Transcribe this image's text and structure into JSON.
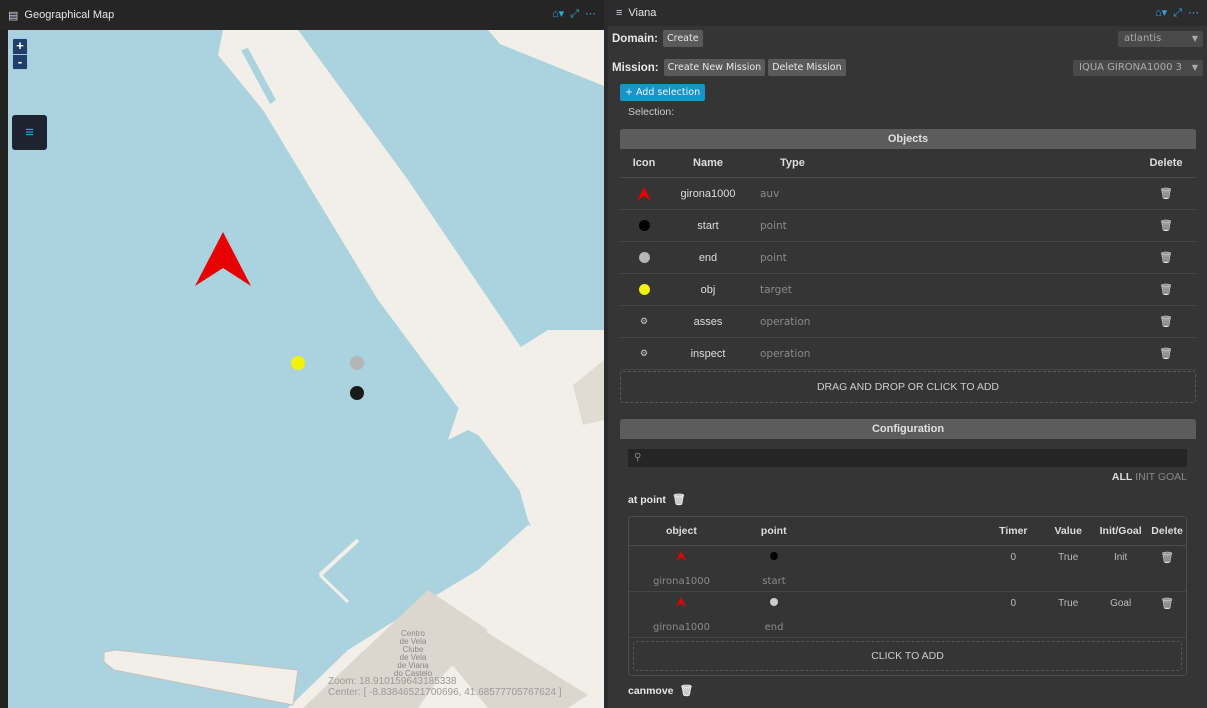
{
  "map_panel": {
    "title": "Geographical Map",
    "zoom_in": "+",
    "zoom_out": "-",
    "place_label": [
      "Centro",
      "de Vela",
      "Clube",
      "de Vela",
      "de Viana",
      "do Castelo"
    ],
    "zoom_text": "Zoom: 18.910159643185338",
    "center_text": "Center: [ -8.83846521700696, 41.68577705767624 ]",
    "markers": {
      "auv_color": "#e60000",
      "yellow": "#f2f20a",
      "gray": "#b5b5b5",
      "black": "#1a1a1a"
    }
  },
  "right_panel": {
    "title": "Viana",
    "domain_label": "Domain:",
    "create_button": "Create",
    "domain_select": "atlantis",
    "mission_label": "Mission:",
    "create_mission_button": "Create New Mission",
    "delete_mission_button": "Delete Mission",
    "mission_select": "IQUA GIRONA1000 3",
    "add_selection_button": "+ Add selection",
    "selection_label": "Selection:",
    "objects_title": "Objects",
    "objects_headers": [
      "Icon",
      "Name",
      "Type",
      "Delete"
    ],
    "objects": [
      {
        "icon": "auv-arrow-icon",
        "name": "girona1000",
        "type": "auv",
        "color": "#e60000"
      },
      {
        "icon": "black-dot-icon",
        "name": "start",
        "type": "point",
        "color": "#000000"
      },
      {
        "icon": "gray-dot-icon",
        "name": "end",
        "type": "point",
        "color": "#b5b5b5"
      },
      {
        "icon": "yellow-dot-icon",
        "name": "obj",
        "type": "target",
        "color": "#f2f20a"
      },
      {
        "icon": "operation-gear-icon",
        "name": "asses",
        "type": "operation",
        "color": "#cccccc"
      },
      {
        "icon": "operation-gear-icon",
        "name": "inspect",
        "type": "operation",
        "color": "#cccccc"
      }
    ],
    "drop_zone": "DRAG AND DROP OR CLICK TO ADD",
    "configuration_title": "Configuration",
    "filter": {
      "all": "ALL",
      "init": "INIT",
      "goal": "GOAL"
    },
    "predicate_at_point": "at point",
    "conf_headers": [
      "object",
      "point",
      "Timer",
      "Value",
      "Init/Goal",
      "Delete"
    ],
    "conf_rows": [
      {
        "object": "girona1000",
        "point": "start",
        "point_color": "#000000",
        "timer": "0",
        "value": "True",
        "init_goal": "Init"
      },
      {
        "object": "girona1000",
        "point": "end",
        "point_color": "#cccccc",
        "timer": "0",
        "value": "True",
        "init_goal": "Goal"
      }
    ],
    "click_to_add": "CLICK TO ADD",
    "predicate_canmove": "canmove"
  }
}
